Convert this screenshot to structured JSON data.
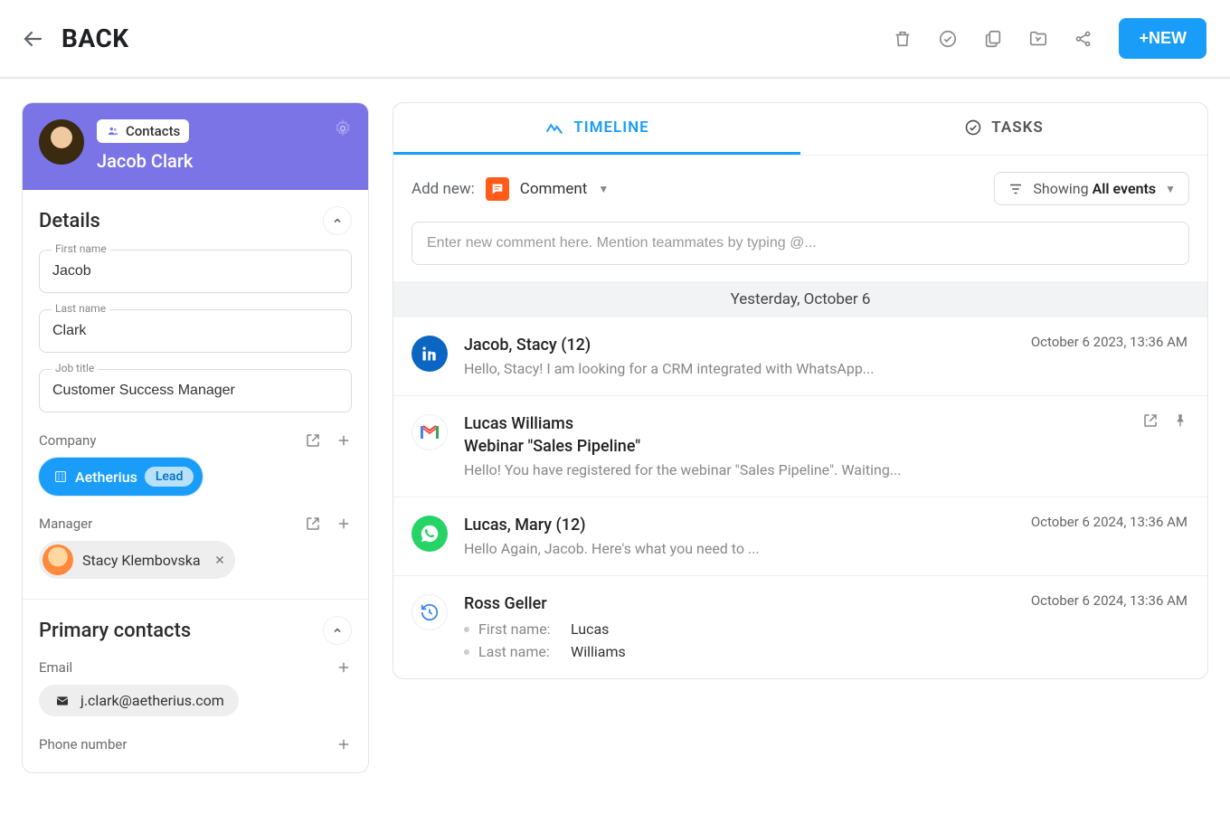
{
  "header": {
    "back_label": "BACK",
    "new_label": "+NEW"
  },
  "contact": {
    "badge_label": "Contacts",
    "name": "Jacob Clark",
    "details_title": "Details",
    "first_name_label": "First name",
    "first_name_value": "Jacob",
    "last_name_label": "Last name",
    "last_name_value": "Clark",
    "job_title_label": "Job title",
    "job_title_value": "Customer Success Manager",
    "company_label": "Company",
    "company_name": "Aetherius",
    "company_tag": "Lead",
    "manager_label": "Manager",
    "manager_name": "Stacy Klembovska",
    "primary_contacts_title": "Primary contacts",
    "email_label": "Email",
    "email_value": "j.clark@aetherius.com",
    "phone_label": "Phone number"
  },
  "tabs": {
    "timeline": "TIMELINE",
    "tasks": "TASKS"
  },
  "controls": {
    "addnew_label": "Add new:",
    "comment_label": "Comment",
    "showing_prefix": "Showing ",
    "showing_value": "All events",
    "comment_placeholder": "Enter new comment here. Mention teammates by typing @..."
  },
  "date_separator": "Yesterday, October 6",
  "events": [
    {
      "icon": "linkedin",
      "title": "Jacob, Stacy (12)",
      "text": "Hello, Stacy! I am looking for a CRM integrated with WhatsApp...",
      "timestamp": "October 6 2023, 13:36 AM"
    },
    {
      "icon": "gmail",
      "title": "Lucas Williams",
      "subtitle": "Webinar \"Sales Pipeline\"",
      "text": "Hello! You have registered for the webinar \"Sales Pipeline\". Waiting...",
      "actions": true
    },
    {
      "icon": "whatsapp",
      "title": "Lucas, Mary (12)",
      "text": "Hello Again, Jacob. Here's what you need to ...",
      "timestamp": "October 6 2024, 13:36 AM"
    },
    {
      "icon": "history",
      "title": "Ross Geller",
      "timestamp": "October 6 2024, 13:36 AM",
      "fields": [
        {
          "label": "First name:",
          "value": "Lucas"
        },
        {
          "label": "Last name:",
          "value": "Williams"
        }
      ]
    }
  ]
}
